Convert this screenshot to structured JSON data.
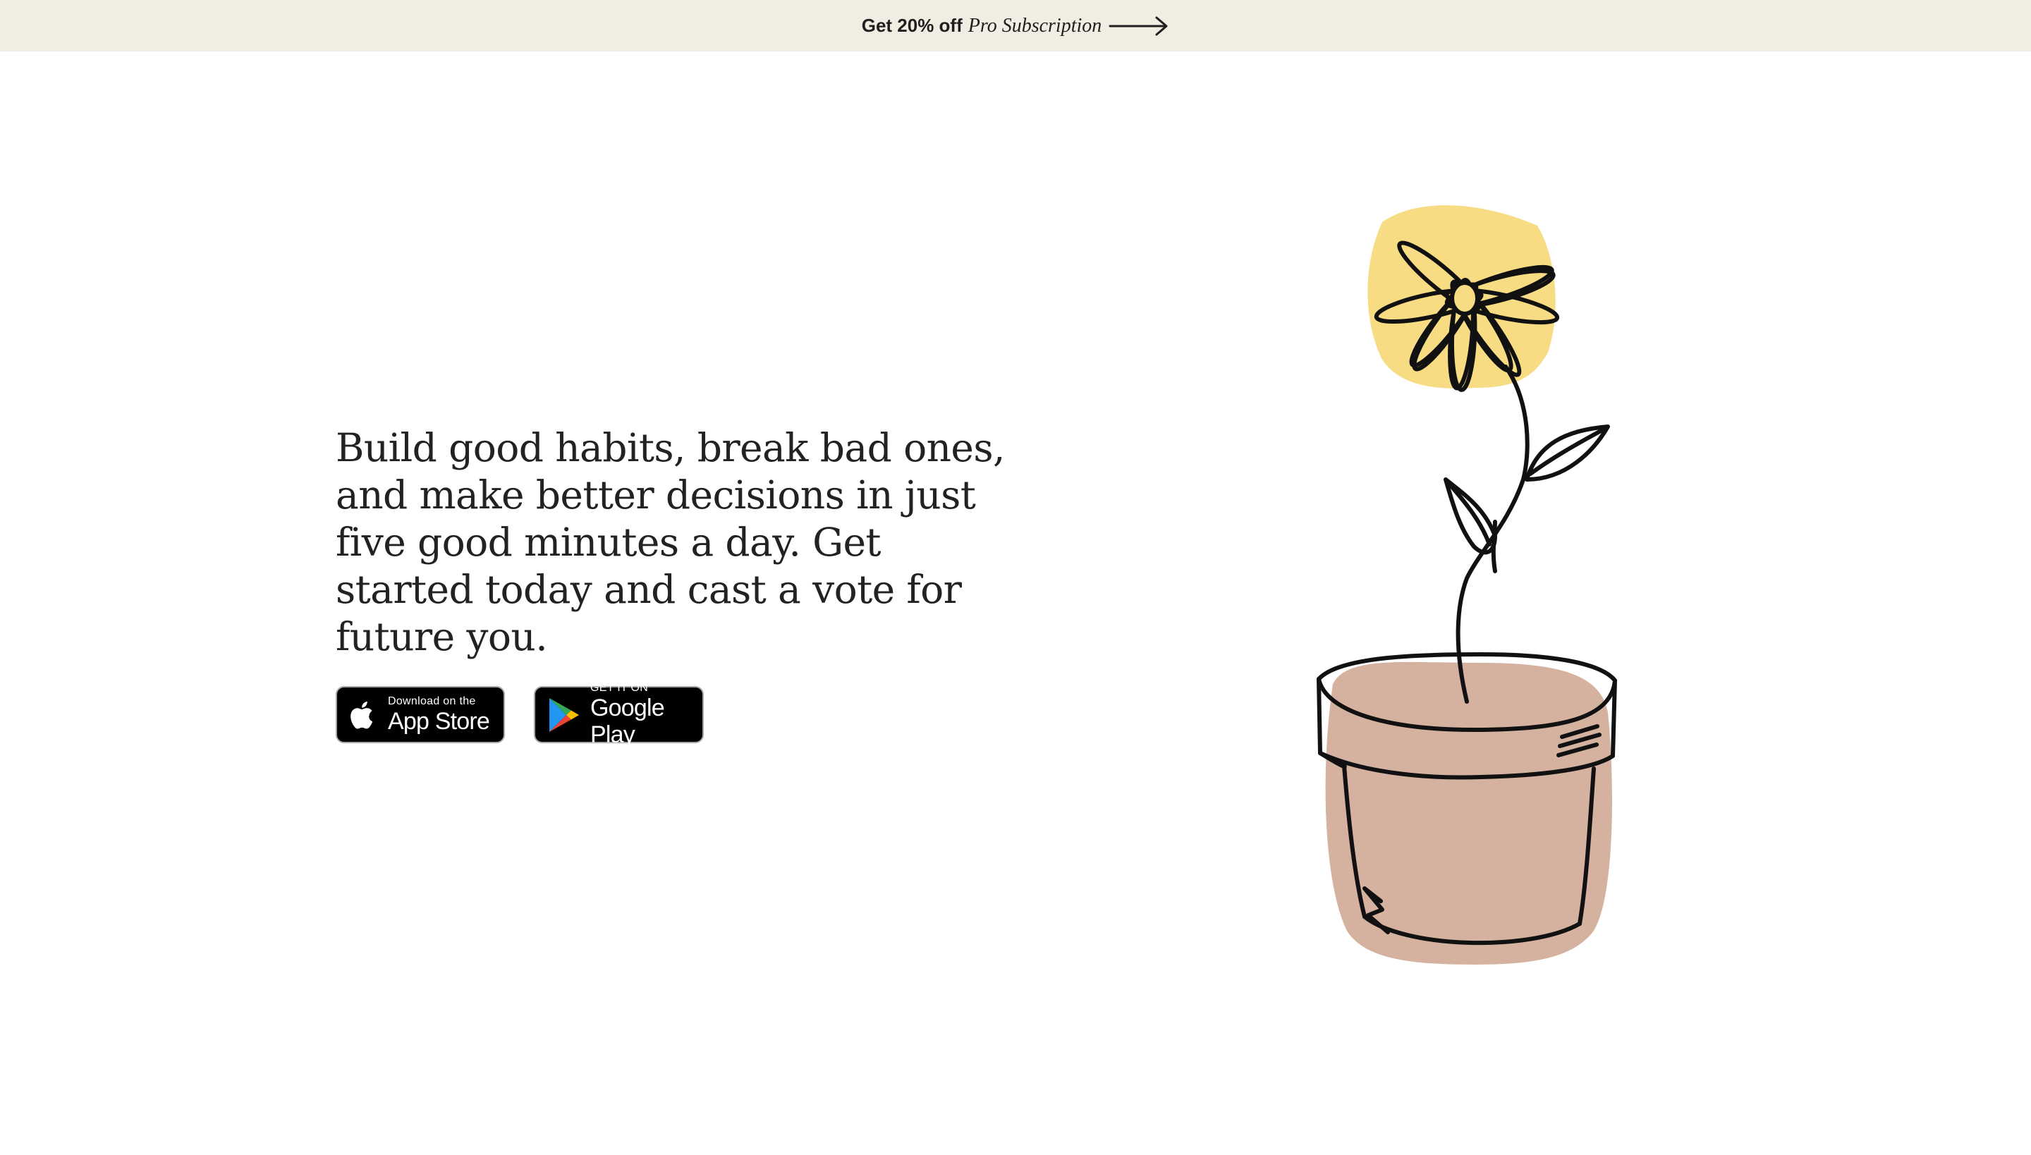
{
  "promo": {
    "bold_text": "Get 20% off",
    "italic_text": "Pro Subscription",
    "icon": "arrow-right-icon"
  },
  "hero": {
    "description": "Build good habits, break bad ones, and make better decisions in just five good minutes a day. Get started today and cast a vote for future you."
  },
  "badges": {
    "app_store": {
      "small": "Download on the",
      "large": "App Store",
      "icon": "apple-icon"
    },
    "google_play": {
      "small": "GET IT ON",
      "large": "Google Play",
      "icon": "google-play-icon"
    }
  },
  "illustration": {
    "name": "flower-in-pot-illustration",
    "colors": {
      "petals_fill": "#f8dc83",
      "pot_fill": "#d4b29f",
      "line": "#111111"
    }
  },
  "colors": {
    "promo_background": "#f1ede3",
    "text": "#222222",
    "badge_background": "#000000"
  }
}
